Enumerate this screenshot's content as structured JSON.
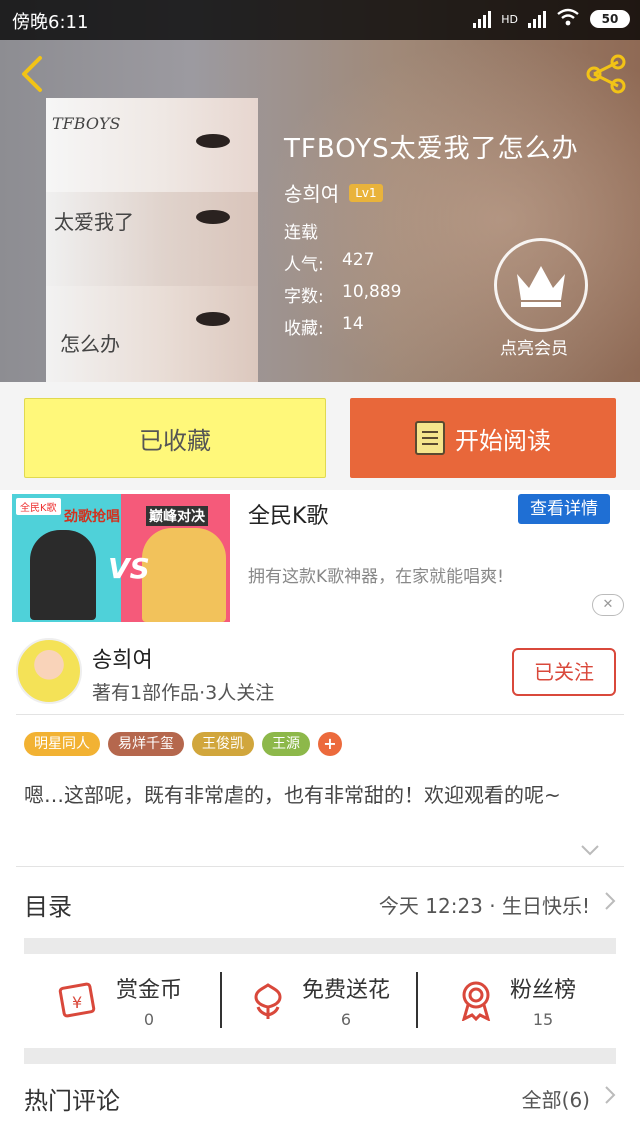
{
  "status_bar": {
    "time": "傍晚6:11",
    "network": "HD",
    "battery": "50"
  },
  "book": {
    "title": "TFBOYS太爱我了怎么办",
    "author": "송희여",
    "level": "Lv1",
    "cover_texts": [
      "TFBOYS",
      "太爱我了",
      "怎么办"
    ],
    "status": "连载",
    "popularity_label": "人气:",
    "popularity": "427",
    "words_label": "字数:",
    "words": "10,889",
    "favorites_label": "收藏:",
    "favorites": "14",
    "vip_label": "点亮会员"
  },
  "actions": {
    "favorited_label": "已收藏",
    "read_label": "开始阅读"
  },
  "ad": {
    "name": "全民K歌",
    "detail_button": "查看详情",
    "description": "拥有这款K歌神器，在家就能唱爽!",
    "close": "✕",
    "image_logo": "全民K歌",
    "image_text1": "劲歌抢唱",
    "image_text2": "巅峰对决",
    "image_vs": "VS"
  },
  "author_card": {
    "name": "송희여",
    "info": "著有1部作品·3人关注",
    "follow_label": "已关注",
    "tags": [
      {
        "label": "明星同人",
        "color": "#f2b233"
      },
      {
        "label": "易烊千玺",
        "color": "#b5674d"
      },
      {
        "label": "王俊凯",
        "color": "#d1a63c"
      },
      {
        "label": "王源",
        "color": "#8db84a"
      },
      {
        "label": "+",
        "color": "#ec6a3c"
      }
    ],
    "intro": "嗯…这部呢，既有非常虐的，也有非常甜的！欢迎观看的呢~"
  },
  "catalog": {
    "label": "目录",
    "latest": "今天 12:23 · 生日快乐!"
  },
  "stats": {
    "reward": {
      "label": "赏金币",
      "value": "0"
    },
    "flowers": {
      "label": "免费送花",
      "value": "6"
    },
    "fans": {
      "label": "粉丝榜",
      "value": "15"
    }
  },
  "comments": {
    "label": "热门评论",
    "all": "全部(6)"
  }
}
